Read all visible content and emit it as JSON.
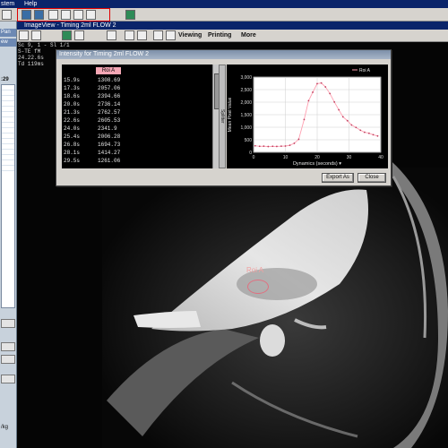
{
  "menubar": {
    "items": [
      "stem",
      "Help"
    ]
  },
  "imageview": {
    "title": "ImageView - Timing 2ml FLOW 2",
    "menus": [
      "Viewing",
      "Printing",
      "More"
    ]
  },
  "left_panel": {
    "tab_label": "Pan",
    "mid_label": "ew",
    "time": ":29",
    "unit": "/kg"
  },
  "overlay": {
    "lines": [
      "Sc 9, 1 - Sl 1/1",
      "S-TE   fM",
      "24.22.6s",
      "Td 119ms"
    ]
  },
  "roi": {
    "label": "Roi A"
  },
  "dialog": {
    "title": "Intensity for Timing 2ml FLOW 2",
    "column_header": "Roi A",
    "splitter_label": "Splitter",
    "rows": [
      {
        "t": "15.9s",
        "v": "1308.69"
      },
      {
        "t": "17.3s",
        "v": "2057.06"
      },
      {
        "t": "18.6s",
        "v": "2394.66"
      },
      {
        "t": "20.0s",
        "v": "2736.14"
      },
      {
        "t": "21.3s",
        "v": "2762.57"
      },
      {
        "t": "22.6s",
        "v": "2605.53"
      },
      {
        "t": "24.0s",
        "v": "2341.9"
      },
      {
        "t": "25.4s",
        "v": "2006.28"
      },
      {
        "t": "26.8s",
        "v": "1694.73"
      },
      {
        "t": "28.1s",
        "v": "1414.27"
      },
      {
        "t": "29.5s",
        "v": "1261.06"
      }
    ],
    "buttons": {
      "export": "Export As",
      "close": "Close"
    }
  },
  "chart_data": {
    "type": "line",
    "xlabel": "Dynamics (seconds)",
    "ylabel": "Mean Pixel Value",
    "xlim": [
      0,
      40
    ],
    "ylim": [
      0,
      3000
    ],
    "xticks": [
      "0",
      "10",
      "20",
      "30",
      "40"
    ],
    "yticks": [
      "0",
      "500",
      "1,000",
      "1,500",
      "2,000",
      "2,500",
      "3,000"
    ],
    "legend": "top-right",
    "series": [
      {
        "name": "Roi A",
        "color": "#ff9fb0",
        "x": [
          0.5,
          1.9,
          3.2,
          4.6,
          6.0,
          7.3,
          8.7,
          10.0,
          11.4,
          12.8,
          14.2,
          15.9,
          17.3,
          18.6,
          20.0,
          21.3,
          22.6,
          24.0,
          25.4,
          26.8,
          28.1,
          29.5,
          30.8,
          32.2,
          33.6,
          34.9,
          36.3,
          37.6,
          39.0
        ],
        "y": [
          260,
          240,
          245,
          230,
          240,
          235,
          245,
          250,
          280,
          360,
          520,
          1308.69,
          2057.06,
          2394.66,
          2736.14,
          2762.57,
          2605.53,
          2341.9,
          2006.28,
          1694.73,
          1414.27,
          1261.06,
          1090,
          990,
          880,
          800,
          760,
          700,
          650
        ]
      }
    ]
  },
  "colors": {
    "title_bar": "#0a246a",
    "chrome": "#d6d3ce",
    "roi_pink": "#f4a6b4",
    "alert_red": "#e21a1a"
  }
}
